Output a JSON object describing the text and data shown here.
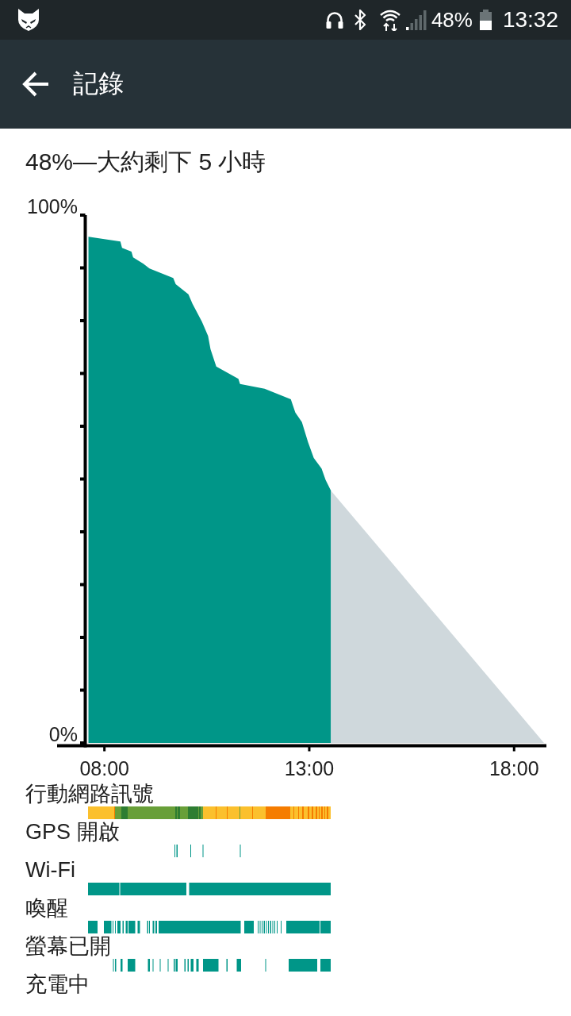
{
  "status_bar": {
    "battery": "48%",
    "time": "13:32"
  },
  "app_bar": {
    "title": "記錄"
  },
  "summary": "48%—大約剩下 5 小時",
  "history_chart": {
    "chart_data": {
      "type": "area",
      "x": [
        7.61,
        8.39,
        8.43,
        8.66,
        8.7,
        8.95,
        9.1,
        9.68,
        9.74,
        10.05,
        10.15,
        10.38,
        10.53,
        10.59,
        10.73,
        11.27,
        11.31,
        11.91,
        12.55,
        12.66,
        12.82,
        12.97,
        13.11,
        13.3,
        13.4,
        13.53,
        18.73
      ],
      "series": [
        {
          "color": "#009688",
          "values": [
            95.9,
            95,
            93.8,
            93.1,
            92,
            90.8,
            89.9,
            88.1,
            86.9,
            85,
            83.2,
            79.8,
            77.1,
            74.6,
            71.3,
            69,
            68,
            67.1,
            65.1,
            62.6,
            60.8,
            57,
            54,
            52,
            49.8,
            47.8,
            null
          ]
        },
        {
          "color": "#cfd8dc",
          "values": [
            null,
            null,
            null,
            null,
            null,
            null,
            null,
            null,
            null,
            null,
            null,
            null,
            null,
            null,
            null,
            null,
            null,
            null,
            null,
            null,
            null,
            null,
            null,
            null,
            null,
            47.8,
            0
          ]
        }
      ],
      "xlim": [
        7.6,
        18.75
      ],
      "ylim": [
        0,
        100
      ],
      "xticks": [
        {
          "value": 8,
          "label": "08:00"
        },
        {
          "value": 13,
          "label": "13:00"
        },
        {
          "value": 18,
          "label": "18:00"
        }
      ],
      "yticks": [
        {
          "value": 0,
          "label": "0%"
        },
        {
          "value": 100,
          "label": "100%"
        }
      ]
    }
  },
  "timelines": [
    {
      "label": "行動網路訊號",
      "kind": "signal"
    },
    {
      "label": "GPS 開啟",
      "kind": "activity"
    },
    {
      "label": "Wi-Fi",
      "kind": "activity"
    },
    {
      "label": "喚醒",
      "kind": "activity"
    },
    {
      "label": "螢幕已開",
      "kind": "activity"
    },
    {
      "label": "充電中",
      "kind": "activity"
    }
  ]
}
